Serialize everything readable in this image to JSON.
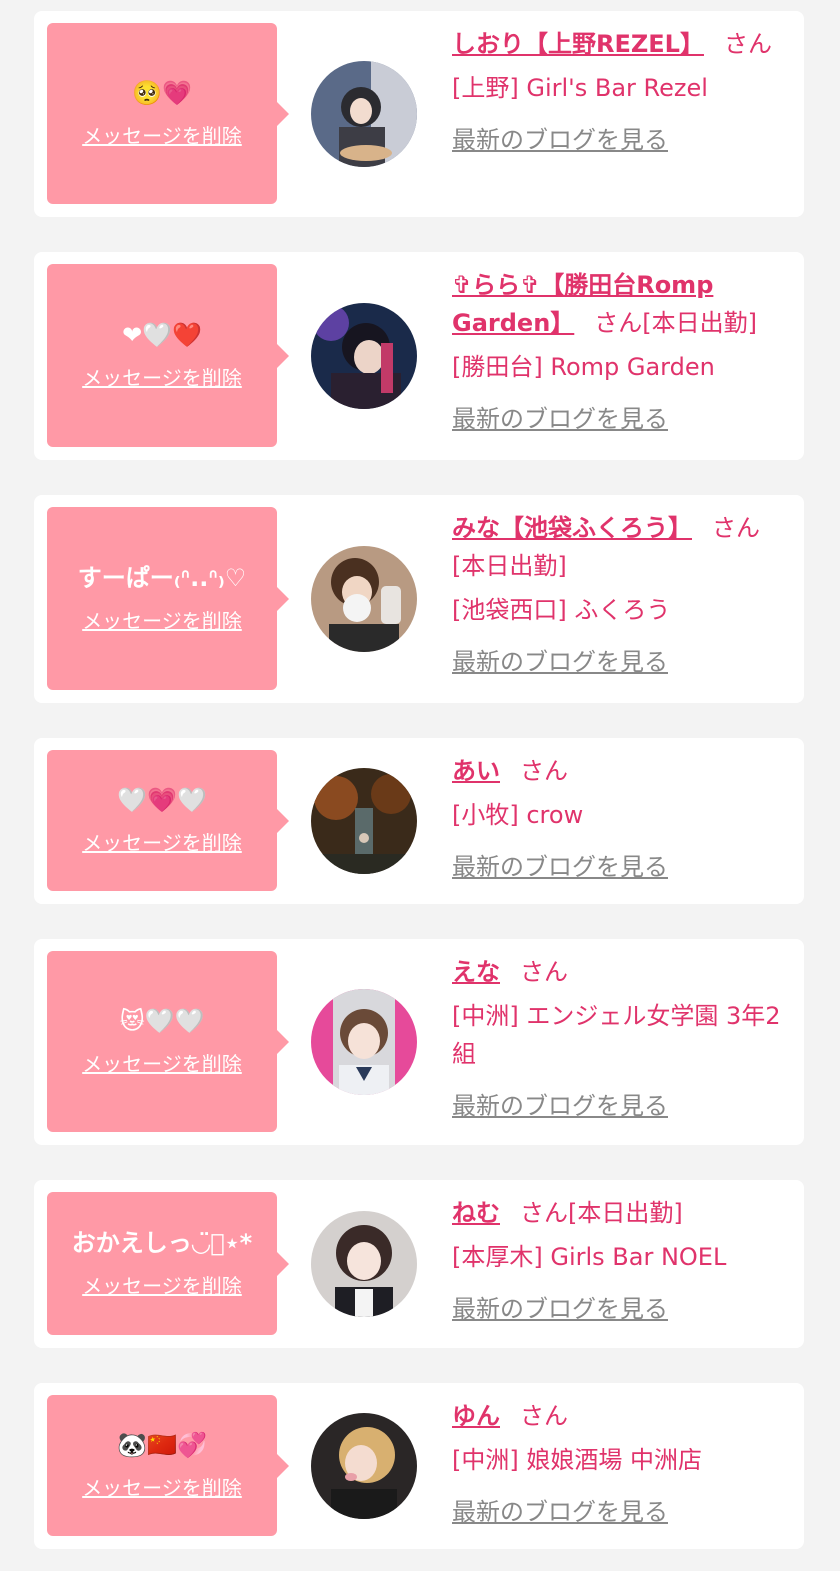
{
  "colors": {
    "accent": "#e0336b",
    "bubble": "#ff99a6",
    "link_muted": "#888888",
    "background": "#f3f3f3"
  },
  "labels": {
    "delete": "メッセージを削除",
    "blog": "最新のブログを見る",
    "san": "さん",
    "today": "[本日出勤]"
  },
  "entries": [
    {
      "message": "🥺💗",
      "name": "しおり【上野REZEL】",
      "shop": "[上野] Girl's Bar Rezel",
      "today": ""
    },
    {
      "message": "❤🤍❤️",
      "name": "✞らら✞【勝田台Romp Garden】",
      "shop": "[勝田台] Romp Garden",
      "today": "[本日出勤]"
    },
    {
      "message": "すーぱー₍ᐢ..ᐢ₎♡",
      "name": "みな【池袋ふくろう】",
      "shop": "[池袋西口] ふくろう",
      "today": "[本日出勤]"
    },
    {
      "message": "🤍💗🤍",
      "name": "あい",
      "shop": "[小牧] crow",
      "today": ""
    },
    {
      "message": "😻🤍🤍",
      "name": "えな",
      "shop": "[中洲] エンジェル女学園 3年2組",
      "today": ""
    },
    {
      "message": "おかえしっ◡̈⃝⋆*",
      "name": "ねむ",
      "shop": "[本厚木] Girls Bar NOEL",
      "today": "[本日出勤]"
    },
    {
      "message": "🐼🇨🇳💞",
      "name": "ゆん",
      "shop": "[中洲] 娘娘酒場 中洲店",
      "today": ""
    }
  ]
}
